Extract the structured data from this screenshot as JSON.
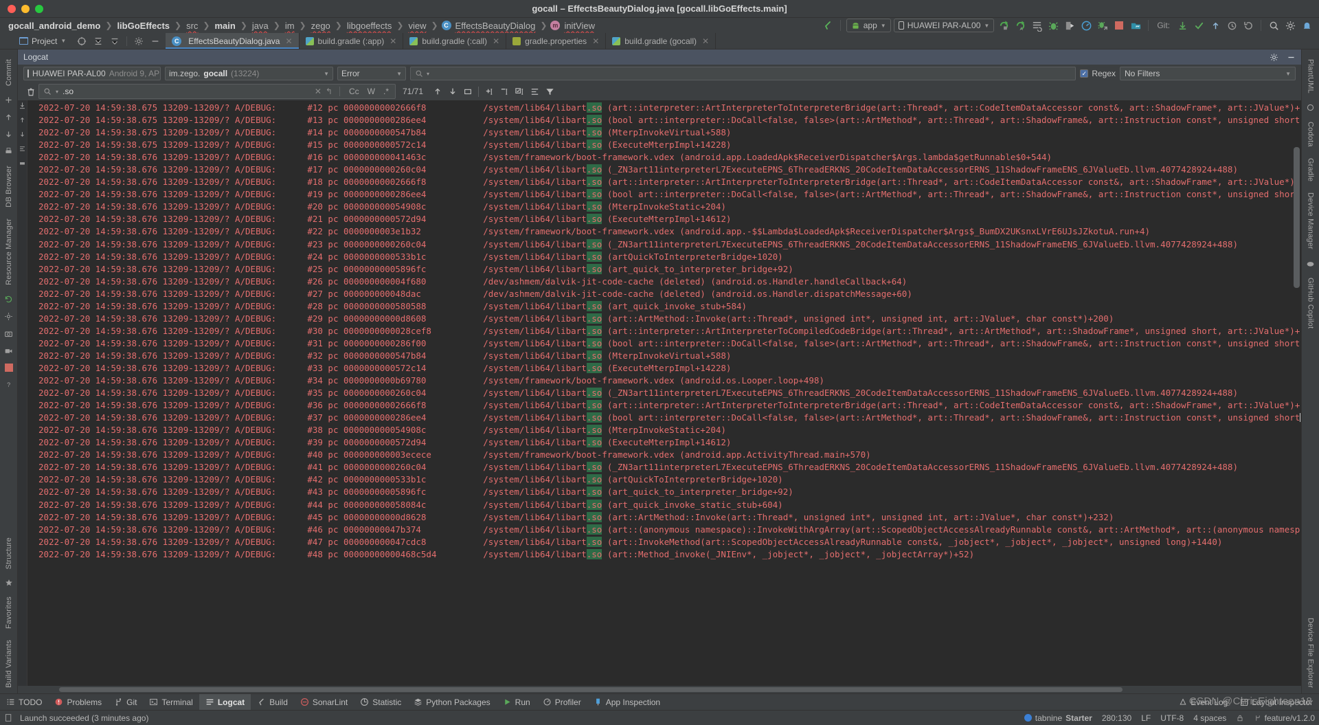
{
  "window": {
    "title": "gocall – EffectsBeautyDialog.java [gocall.libGoEffects.main]"
  },
  "breadcrumbs": [
    {
      "label": "gocall_android_demo",
      "style": "bold"
    },
    {
      "label": "libGoEffects",
      "style": "bold"
    },
    {
      "label": "src",
      "style": "plain"
    },
    {
      "label": "main",
      "style": "bold"
    },
    {
      "label": "java",
      "style": "plain"
    },
    {
      "label": "im",
      "style": "plain"
    },
    {
      "label": "zego",
      "style": "plain"
    },
    {
      "label": "libgoeffects",
      "style": "plain"
    },
    {
      "label": "view",
      "style": "plain"
    },
    {
      "label": "EffectsBeautyDialog",
      "style": "class"
    },
    {
      "label": "initView",
      "style": "method"
    }
  ],
  "toolbar": {
    "run_config": "app",
    "device": "HUAWEI PAR-AL00",
    "git_label": "Git:",
    "icons": [
      "run-icon",
      "debug-run-icon",
      "list-icon",
      "debug-icon",
      "attach-debugger-icon",
      "profiler-icon",
      "apply-changes-icon",
      "stop-icon",
      "device-manager-icon"
    ],
    "git_icons": [
      "update-project-icon",
      "commit-icon",
      "push-icon",
      "history-icon",
      "rollback-icon"
    ],
    "right_icons": [
      "search-everywhere-icon",
      "settings-icon",
      "notifications-icon"
    ]
  },
  "project_button": "Project",
  "editor_tabs": [
    {
      "label": "EffectsBeautyDialog.java",
      "icon": "java-class-icon",
      "active": true,
      "closable": true
    },
    {
      "label": "build.gradle (:app)",
      "icon": "gradle-icon",
      "active": false,
      "closable": true
    },
    {
      "label": "build.gradle (:call)",
      "icon": "gradle-icon",
      "active": false,
      "closable": true
    },
    {
      "label": "gradle.properties",
      "icon": "properties-icon",
      "active": false,
      "closable": true
    },
    {
      "label": "build.gradle (gocall)",
      "icon": "gradle-icon",
      "active": false,
      "closable": true
    }
  ],
  "logcat": {
    "title": "Logcat",
    "header_icons": [
      "settings-icon",
      "minimize-icon"
    ],
    "device_selector": {
      "name": "HUAWEI PAR-AL00",
      "detail": "Android 9, AP"
    },
    "process_selector": {
      "prefix": "im.zego.",
      "bold": "gocall",
      "pid": "(13224)"
    },
    "level_selector": "Error",
    "query_placeholder": "",
    "regex_label": "Regex",
    "regex_checked": true,
    "filter_selector": "No Filters",
    "find": {
      "value": ".so",
      "match_count": "71/71",
      "toggles": [
        "Cc",
        "W",
        ".*"
      ],
      "icons": [
        "trash-icon",
        "search-icon",
        "clear-icon",
        "return-icon",
        "prev-icon",
        "next-icon",
        "select-all-icon",
        "add-lines-icon",
        "remove-lines-icon",
        "check-lines-icon",
        "wrap-icon",
        "filter-icon"
      ]
    }
  },
  "log_lines": [
    {
      "ts": "2022-07-20 14:59:38.675",
      "pidtid": "13209-13209/?",
      "tag": "A/DEBUG:",
      "frame": "#12 pc 00000000002666f8",
      "path_pre": "/system/lib64/libart",
      "path_hl": ".so",
      "rest": " (art::interpreter::ArtInterpreterToInterpreterBridge(art::Thread*, art::CodeItemDataAccessor const&, art::ShadowFrame*, art::JValue*)+"
    },
    {
      "ts": "2022-07-20 14:59:38.675",
      "pidtid": "13209-13209/?",
      "tag": "A/DEBUG:",
      "frame": "#13 pc 0000000000286ee4",
      "path_pre": "/system/lib64/libart",
      "path_hl": ".so",
      "rest": " (bool art::interpreter::DoCall<false, false>(art::ArtMethod*, art::Thread*, art::ShadowFrame&, art::Instruction const*, unsigned short"
    },
    {
      "ts": "2022-07-20 14:59:38.675",
      "pidtid": "13209-13209/?",
      "tag": "A/DEBUG:",
      "frame": "#14 pc 0000000000547b84",
      "path_pre": "/system/lib64/libart",
      "path_hl": ".so",
      "rest": " (MterpInvokeVirtual+588)"
    },
    {
      "ts": "2022-07-20 14:59:38.675",
      "pidtid": "13209-13209/?",
      "tag": "A/DEBUG:",
      "frame": "#15 pc 0000000000572c14",
      "path_pre": "/system/lib64/libart",
      "path_hl": ".so",
      "rest": " (ExecuteMterpImpl+14228)"
    },
    {
      "ts": "2022-07-20 14:59:38.676",
      "pidtid": "13209-13209/?",
      "tag": "A/DEBUG:",
      "frame": "#16 pc 000000000041463c",
      "path_pre": "/system/framework/boot-framework.vdex",
      "path_hl": "",
      "rest": " (android.app.LoadedApk$ReceiverDispatcher$Args.lambda$getRunnable$0+544)"
    },
    {
      "ts": "2022-07-20 14:59:38.676",
      "pidtid": "13209-13209/?",
      "tag": "A/DEBUG:",
      "frame": "#17 pc 0000000000260c04",
      "path_pre": "/system/lib64/libart",
      "path_hl": ".so",
      "rest": " (_ZN3art11interpreterL7ExecuteEPNS_6ThreadERKNS_20CodeItemDataAccessorERNS_11ShadowFrameENS_6JValueEb.llvm.4077428924+488)"
    },
    {
      "ts": "2022-07-20 14:59:38.676",
      "pidtid": "13209-13209/?",
      "tag": "A/DEBUG:",
      "frame": "#18 pc 00000000002666f8",
      "path_pre": "/system/lib64/libart",
      "path_hl": ".so",
      "rest": " (art::interpreter::ArtInterpreterToInterpreterBridge(art::Thread*, art::CodeItemDataAccessor const&, art::ShadowFrame*, art::JValue*)+"
    },
    {
      "ts": "2022-07-20 14:59:38.676",
      "pidtid": "13209-13209/?",
      "tag": "A/DEBUG:",
      "frame": "#19 pc 0000000000286ee4",
      "path_pre": "/system/lib64/libart",
      "path_hl": ".so",
      "rest": " (bool art::interpreter::DoCall<false, false>(art::ArtMethod*, art::Thread*, art::ShadowFrame&, art::Instruction const*, unsigned short"
    },
    {
      "ts": "2022-07-20 14:59:38.676",
      "pidtid": "13209-13209/?",
      "tag": "A/DEBUG:",
      "frame": "#20 pc 000000000054908c",
      "path_pre": "/system/lib64/libart",
      "path_hl": ".so",
      "rest": " (MterpInvokeStatic+204)"
    },
    {
      "ts": "2022-07-20 14:59:38.676",
      "pidtid": "13209-13209/?",
      "tag": "A/DEBUG:",
      "frame": "#21 pc 0000000000572d94",
      "path_pre": "/system/lib64/libart",
      "path_hl": ".so",
      "rest": " (ExecuteMterpImpl+14612)"
    },
    {
      "ts": "2022-07-20 14:59:38.676",
      "pidtid": "13209-13209/?",
      "tag": "A/DEBUG:",
      "frame": "#22 pc 0000000003e1b32",
      "path_pre": "/system/framework/boot-framework.vdex",
      "path_hl": "",
      "rest": " (android.app.-$$Lambda$LoadedApk$ReceiverDispatcher$Args$_BumDX2UKsnxLVrE6UJsJZkotuA.run+4)"
    },
    {
      "ts": "2022-07-20 14:59:38.676",
      "pidtid": "13209-13209/?",
      "tag": "A/DEBUG:",
      "frame": "#23 pc 0000000000260c04",
      "path_pre": "/system/lib64/libart",
      "path_hl": ".so",
      "rest": " (_ZN3art11interpreterL7ExecuteEPNS_6ThreadERKNS_20CodeItemDataAccessorERNS_11ShadowFrameENS_6JValueEb.llvm.4077428924+488)"
    },
    {
      "ts": "2022-07-20 14:59:38.676",
      "pidtid": "13209-13209/?",
      "tag": "A/DEBUG:",
      "frame": "#24 pc 0000000000533b1c",
      "path_pre": "/system/lib64/libart",
      "path_hl": ".so",
      "rest": " (artQuickToInterpreterBridge+1020)"
    },
    {
      "ts": "2022-07-20 14:59:38.676",
      "pidtid": "13209-13209/?",
      "tag": "A/DEBUG:",
      "frame": "#25 pc 00000000005896fc",
      "path_pre": "/system/lib64/libart",
      "path_hl": ".so",
      "rest": " (art_quick_to_interpreter_bridge+92)"
    },
    {
      "ts": "2022-07-20 14:59:38.676",
      "pidtid": "13209-13209/?",
      "tag": "A/DEBUG:",
      "frame": "#26 pc 000000000004f680",
      "path_pre": "/dev/ashmem/dalvik-jit-code-cache (deleted)",
      "path_hl": "",
      "rest": " (android.os.Handler.handleCallback+64)"
    },
    {
      "ts": "2022-07-20 14:59:38.676",
      "pidtid": "13209-13209/?",
      "tag": "A/DEBUG:",
      "frame": "#27 pc 000000000048dac",
      "path_pre": "/dev/ashmem/dalvik-jit-code-cache (deleted)",
      "path_hl": "",
      "rest": " (android.os.Handler.dispatchMessage+60)"
    },
    {
      "ts": "2022-07-20 14:59:38.676",
      "pidtid": "13209-13209/?",
      "tag": "A/DEBUG:",
      "frame": "#28 pc 0000000000580588",
      "path_pre": "/system/lib64/libart",
      "path_hl": ".so",
      "rest": " (art_quick_invoke_stub+584)"
    },
    {
      "ts": "2022-07-20 14:59:38.676",
      "pidtid": "13209-13209/?",
      "tag": "A/DEBUG:",
      "frame": "#29 pc 00000000000d8608",
      "path_pre": "/system/lib64/libart",
      "path_hl": ".so",
      "rest": " (art::ArtMethod::Invoke(art::Thread*, unsigned int*, unsigned int, art::JValue*, char const*)+200)"
    },
    {
      "ts": "2022-07-20 14:59:38.676",
      "pidtid": "13209-13209/?",
      "tag": "A/DEBUG:",
      "frame": "#30 pc 0000000000028cef8",
      "path_pre": "/system/lib64/libart",
      "path_hl": ".so",
      "rest": " (art::interpreter::ArtInterpreterToCompiledCodeBridge(art::Thread*, art::ArtMethod*, art::ShadowFrame*, unsigned short, art::JValue*)+"
    },
    {
      "ts": "2022-07-20 14:59:38.676",
      "pidtid": "13209-13209/?",
      "tag": "A/DEBUG:",
      "frame": "#31 pc 0000000000286f00",
      "path_pre": "/system/lib64/libart",
      "path_hl": ".so",
      "rest": " (bool art::interpreter::DoCall<false, false>(art::ArtMethod*, art::Thread*, art::ShadowFrame&, art::Instruction const*, unsigned short"
    },
    {
      "ts": "2022-07-20 14:59:38.676",
      "pidtid": "13209-13209/?",
      "tag": "A/DEBUG:",
      "frame": "#32 pc 0000000000547b84",
      "path_pre": "/system/lib64/libart",
      "path_hl": ".so",
      "rest": " (MterpInvokeVirtual+588)"
    },
    {
      "ts": "2022-07-20 14:59:38.676",
      "pidtid": "13209-13209/?",
      "tag": "A/DEBUG:",
      "frame": "#33 pc 0000000000572c14",
      "path_pre": "/system/lib64/libart",
      "path_hl": ".so",
      "rest": " (ExecuteMterpImpl+14228)"
    },
    {
      "ts": "2022-07-20 14:59:38.676",
      "pidtid": "13209-13209/?",
      "tag": "A/DEBUG:",
      "frame": "#34 pc 0000000000b69780",
      "path_pre": "/system/framework/boot-framework.vdex",
      "path_hl": "",
      "rest": " (android.os.Looper.loop+498)"
    },
    {
      "ts": "2022-07-20 14:59:38.676",
      "pidtid": "13209-13209/?",
      "tag": "A/DEBUG:",
      "frame": "#35 pc 0000000000260c04",
      "path_pre": "/system/lib64/libart",
      "path_hl": ".so",
      "rest": " (_ZN3art11interpreterL7ExecuteEPNS_6ThreadERKNS_20CodeItemDataAccessorERNS_11ShadowFrameENS_6JValueEb.llvm.4077428924+488)"
    },
    {
      "ts": "2022-07-20 14:59:38.676",
      "pidtid": "13209-13209/?",
      "tag": "A/DEBUG:",
      "frame": "#36 pc 00000000002666f8",
      "path_pre": "/system/lib64/libart",
      "path_hl": ".so",
      "rest": " (art::interpreter::ArtInterpreterToInterpreterBridge(art::Thread*, art::CodeItemDataAccessor const&, art::ShadowFrame*, art::JValue*)+"
    },
    {
      "ts": "2022-07-20 14:59:38.676",
      "pidtid": "13209-13209/?",
      "tag": "A/DEBUG:",
      "frame": "#37 pc 0000000000286ee4",
      "path_pre": "/system/lib64/libart",
      "path_hl": ".so",
      "rest": " (bool art::interpreter::DoCall<false, false>(art::ArtMethod*, art::Thread*, art::ShadowFrame&, art::Instruction const*, unsigned short"
    },
    {
      "ts": "2022-07-20 14:59:38.676",
      "pidtid": "13209-13209/?",
      "tag": "A/DEBUG:",
      "frame": "#38 pc 000000000054908c",
      "path_pre": "/system/lib64/libart",
      "path_hl": ".so",
      "rest": " (MterpInvokeStatic+204)"
    },
    {
      "ts": "2022-07-20 14:59:38.676",
      "pidtid": "13209-13209/?",
      "tag": "A/DEBUG:",
      "frame": "#39 pc 0000000000572d94",
      "path_pre": "/system/lib64/libart",
      "path_hl": ".so",
      "rest": " (ExecuteMterpImpl+14612)"
    },
    {
      "ts": "2022-07-20 14:59:38.676",
      "pidtid": "13209-13209/?",
      "tag": "A/DEBUG:",
      "frame": "#40 pc 000000000003ecece",
      "path_pre": "/system/framework/boot-framework.vdex",
      "path_hl": "",
      "rest": " (android.app.ActivityThread.main+570)"
    },
    {
      "ts": "2022-07-20 14:59:38.676",
      "pidtid": "13209-13209/?",
      "tag": "A/DEBUG:",
      "frame": "#41 pc 0000000000260c04",
      "path_pre": "/system/lib64/libart",
      "path_hl": ".so",
      "rest": " (_ZN3art11interpreterL7ExecuteEPNS_6ThreadERKNS_20CodeItemDataAccessorERNS_11ShadowFrameENS_6JValueEb.llvm.4077428924+488)"
    },
    {
      "ts": "2022-07-20 14:59:38.676",
      "pidtid": "13209-13209/?",
      "tag": "A/DEBUG:",
      "frame": "#42 pc 0000000000533b1c",
      "path_pre": "/system/lib64/libart",
      "path_hl": ".so",
      "rest": " (artQuickToInterpreterBridge+1020)"
    },
    {
      "ts": "2022-07-20 14:59:38.676",
      "pidtid": "13209-13209/?",
      "tag": "A/DEBUG:",
      "frame": "#43 pc 00000000005896fc",
      "path_pre": "/system/lib64/libart",
      "path_hl": ".so",
      "rest": " (art_quick_to_interpreter_bridge+92)"
    },
    {
      "ts": "2022-07-20 14:59:38.676",
      "pidtid": "13209-13209/?",
      "tag": "A/DEBUG:",
      "frame": "#44 pc 000000000058084c",
      "path_pre": "/system/lib64/libart",
      "path_hl": ".so",
      "rest": " (art_quick_invoke_static_stub+604)"
    },
    {
      "ts": "2022-07-20 14:59:38.676",
      "pidtid": "13209-13209/?",
      "tag": "A/DEBUG:",
      "frame": "#45 pc 00000000000d8628",
      "path_pre": "/system/lib64/libart",
      "path_hl": ".so",
      "rest": " (art::ArtMethod::Invoke(art::Thread*, unsigned int*, unsigned int, art::JValue*, char const*)+232)"
    },
    {
      "ts": "2022-07-20 14:59:38.676",
      "pidtid": "13209-13209/?",
      "tag": "A/DEBUG:",
      "frame": "#46 pc 00000000047b374",
      "path_pre": "/system/lib64/libart",
      "path_hl": ".so",
      "rest": " (art::(anonymous namespace)::InvokeWithArgArray(art::ScopedObjectAccessAlreadyRunnable const&, art::ArtMethod*, art::(anonymous namesp"
    },
    {
      "ts": "2022-07-20 14:59:38.676",
      "pidtid": "13209-13209/?",
      "tag": "A/DEBUG:",
      "frame": "#47 pc 000000000047cdc8",
      "path_pre": "/system/lib64/libart",
      "path_hl": ".so",
      "rest": " (art::InvokeMethod(art::ScopedObjectAccessAlreadyRunnable const&, _jobject*, _jobject*, _jobject*, unsigned long)+1440)"
    },
    {
      "ts": "2022-07-20 14:59:38.676",
      "pidtid": "13209-13209/?",
      "tag": "A/DEBUG:",
      "frame": "#48 pc 00000000000468c5d4",
      "path_pre": "/system/lib64/libart",
      "path_hl": ".so",
      "rest": " (art::Method_invoke(_JNIEnv*, _jobject*, _jobject*, _jobjectArray*)+52)"
    }
  ],
  "left_tools": [
    {
      "label": "Commit",
      "icon": "commit-icon"
    },
    {
      "label": "DB Browser",
      "icon": "database-icon"
    },
    {
      "label": "Resource Manager",
      "icon": "resource-icon"
    }
  ],
  "left_bottom_tools": [
    {
      "label": "Structure",
      "icon": "structure-icon"
    },
    {
      "label": "Favorites",
      "icon": "star-icon"
    },
    {
      "label": "Build Variants",
      "icon": "variants-icon"
    }
  ],
  "right_tools": [
    {
      "label": "PlantUML",
      "icon": "plantuml-icon"
    },
    {
      "label": "Codota",
      "icon": "codota-icon"
    },
    {
      "label": "Gradle",
      "icon": "gradle-icon"
    },
    {
      "label": "Device Manager",
      "icon": "device-icon"
    },
    {
      "label": "GitHub Copilot",
      "icon": "copilot-icon"
    },
    {
      "label": "Device File Explorer",
      "icon": "device-file-icon"
    }
  ],
  "bottom_bar": {
    "items": [
      {
        "label": "TODO",
        "icon": "todo-icon",
        "active": false
      },
      {
        "label": "Problems",
        "icon": "problems-icon",
        "active": false
      },
      {
        "label": "Git",
        "icon": "git-icon",
        "active": false
      },
      {
        "label": "Terminal",
        "icon": "terminal-icon",
        "active": false
      },
      {
        "label": "Logcat",
        "icon": "logcat-icon",
        "active": true
      },
      {
        "label": "Build",
        "icon": "build-icon",
        "active": false
      },
      {
        "label": "SonarLint",
        "icon": "sonarlint-icon",
        "active": false
      },
      {
        "label": "Statistic",
        "icon": "statistic-icon",
        "active": false
      },
      {
        "label": "Python Packages",
        "icon": "python-icon",
        "active": false
      },
      {
        "label": "Run",
        "icon": "run-icon",
        "active": false
      },
      {
        "label": "Profiler",
        "icon": "profiler-icon",
        "active": false
      },
      {
        "label": "App Inspection",
        "icon": "app-inspection-icon",
        "active": false
      }
    ],
    "right_items": [
      {
        "label": "Event Log",
        "icon": "event-log-icon"
      },
      {
        "label": "Layout Inspector",
        "icon": "layout-inspector-icon"
      }
    ]
  },
  "status_bar": {
    "message": "Launch succeeded (3 minutes ago)",
    "tabnine": "tabnine",
    "tabnine_state": "Starter",
    "caret": "280:130",
    "line_sep": "LF",
    "encoding": "UTF-8",
    "indent": "4 spaces",
    "branch": "feature/v1.2.0"
  },
  "watermark": "CSDN @ChrisEighteen18"
}
